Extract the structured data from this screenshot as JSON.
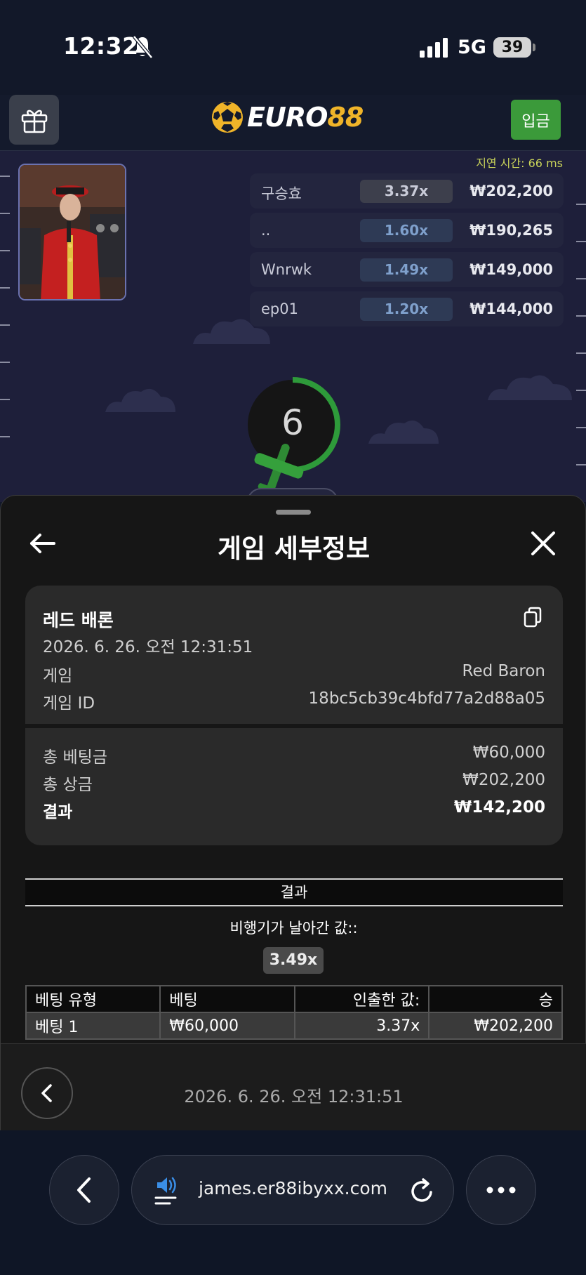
{
  "status": {
    "time": "12:32",
    "network": "5G",
    "battery": "39"
  },
  "header": {
    "logo_part1": "EURO",
    "logo_part2": "88",
    "deposit_label": "입금"
  },
  "game": {
    "latency": "지연 시간: 66 ms",
    "countdown": "6",
    "leaderboard": [
      {
        "name": "구승효",
        "multiplier": "3.37x",
        "amount": "₩202,200"
      },
      {
        "name": "..",
        "multiplier": "1.60x",
        "amount": "₩190,265"
      },
      {
        "name": "Wnrwk",
        "multiplier": "1.49x",
        "amount": "₩149,000"
      },
      {
        "name": "ep01",
        "multiplier": "1.20x",
        "amount": "₩144,000"
      }
    ]
  },
  "sheet": {
    "title": "게임 세부정보",
    "card": {
      "game_name": "레드 배론",
      "datetime": "2026. 6. 26. 오전 12:31:51",
      "game_label": "게임",
      "game_value": "Red Baron",
      "id_label": "게임 ID",
      "id_value": "18bc5cb39c4bfd77a2d88a05",
      "total_bet_label": "총 베팅금",
      "total_bet_value": "₩60,000",
      "total_prize_label": "총 상금",
      "total_prize_value": "₩202,200",
      "result_label": "결과",
      "result_value": "₩142,200"
    },
    "result_header": "결과",
    "plane_label": "비행기가 날아간 값::",
    "plane_multiplier": "3.49x",
    "table": {
      "headers": [
        "베팅 유형",
        "베팅",
        "인출한 값:",
        "승"
      ],
      "rows": [
        [
          "베팅 1",
          "₩60,000",
          "3.37x",
          "₩202,200"
        ]
      ]
    },
    "footer_date": "2026. 6. 26. 오전 12:31:51"
  },
  "browser": {
    "url": "james.er88ibyxx.com"
  },
  "colors": {
    "accent_green": "#3b9a3a",
    "logo_gold": "#f0b429",
    "countdown_ring": "#2e9a3a"
  }
}
